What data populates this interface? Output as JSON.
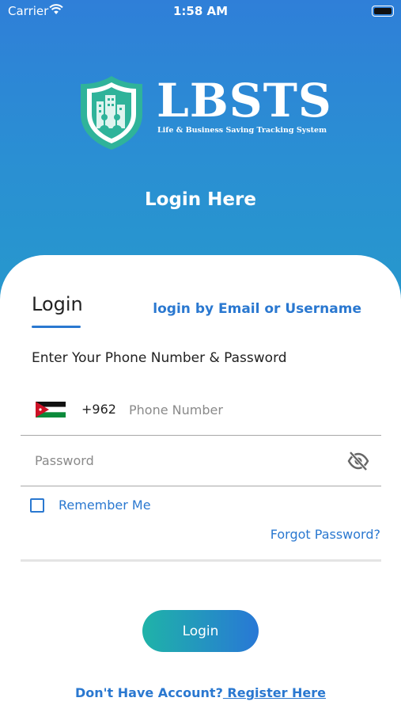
{
  "status_bar": {
    "carrier": "Carrier",
    "time": "1:58 AM"
  },
  "brand": {
    "title": "LBSTS",
    "subtitle": "Life & Business Saving Tracking System"
  },
  "hero": {
    "title": "Login Here"
  },
  "form": {
    "tab_label": "Login",
    "alt_login_label": "login by Email or Username",
    "instructions": "Enter Your Phone Number & Password",
    "country_code": "+962",
    "phone_placeholder": "Phone Number",
    "phone_value": "",
    "password_placeholder": "Password",
    "password_value": "",
    "remember_label": "Remember Me",
    "remember_checked": false,
    "forgot_label": "Forgot Password?",
    "login_button": "Login",
    "register_prompt": "Don't Have Account?",
    "register_link": " Register Here"
  },
  "icons": {
    "flag": "jordan-flag-icon",
    "password_toggle": "eye-off-icon",
    "wifi": "wifi-icon",
    "battery": "battery-icon",
    "logo": "shield-logo-icon"
  },
  "colors": {
    "accent": "#2a78d0",
    "hero_gradient_top": "#2f7fd8",
    "hero_gradient_bottom": "#2699cc",
    "button_gradient_start": "#1fb3a8",
    "button_gradient_end": "#2878d6",
    "logo_green": "#2fb39a"
  }
}
